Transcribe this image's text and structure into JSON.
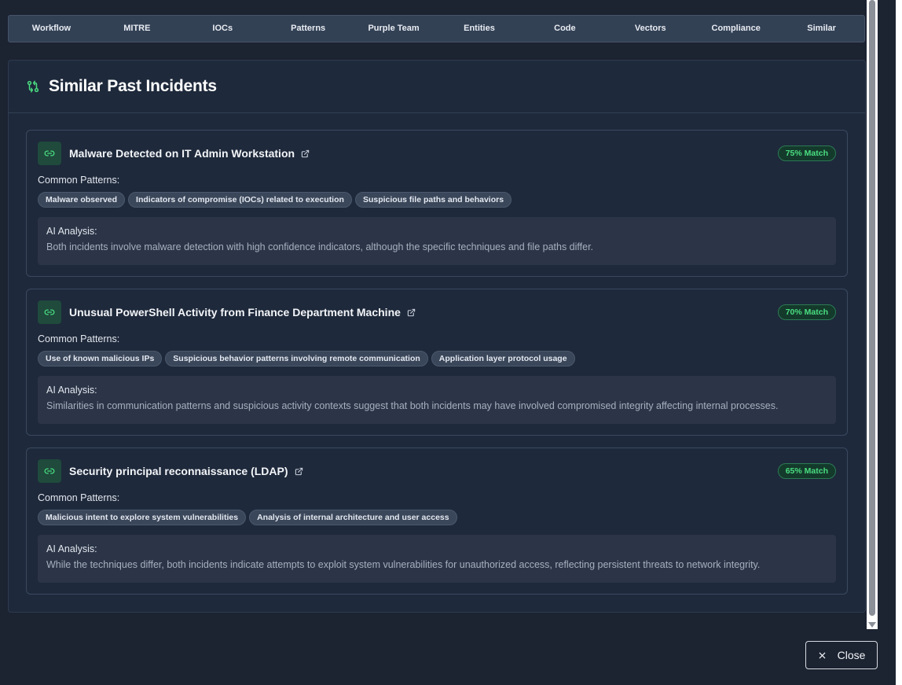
{
  "tabs": [
    "Workflow",
    "MITRE",
    "IOCs",
    "Patterns",
    "Purple Team",
    "Entities",
    "Code",
    "Vectors",
    "Compliance",
    "Similar"
  ],
  "panel": {
    "title": "Similar Past Incidents",
    "icon": "git-compare-icon"
  },
  "labels": {
    "common_patterns": "Common Patterns:",
    "ai_analysis": "AI Analysis:"
  },
  "incidents": [
    {
      "title": "Malware Detected on IT Admin Workstation",
      "match": "75% Match",
      "patterns": [
        "Malware observed",
        "Indicators of compromise (IOCs) related to execution",
        "Suspicious file paths and behaviors"
      ],
      "analysis": "Both incidents involve malware detection with high confidence indicators, although the specific techniques and file paths differ."
    },
    {
      "title": "Unusual PowerShell Activity from Finance Department Machine",
      "match": "70% Match",
      "patterns": [
        "Use of known malicious IPs",
        "Suspicious behavior patterns involving remote communication",
        "Application layer protocol usage"
      ],
      "analysis": "Similarities in communication patterns and suspicious activity contexts suggest that both incidents may have involved compromised integrity affecting internal processes."
    },
    {
      "title": "Security principal reconnaissance (LDAP)",
      "match": "65% Match",
      "patterns": [
        "Malicious intent to explore system vulnerabilities",
        "Analysis of internal architecture and user access"
      ],
      "analysis": "While the techniques differ, both incidents indicate attempts to exploit system vulnerabilities for unauthorized access, reflecting persistent threats to network integrity."
    }
  ],
  "close_button": {
    "label": "Close"
  },
  "colors": {
    "accent": "#4ade80",
    "background": "#1c2331",
    "panel": "#1e293b"
  }
}
